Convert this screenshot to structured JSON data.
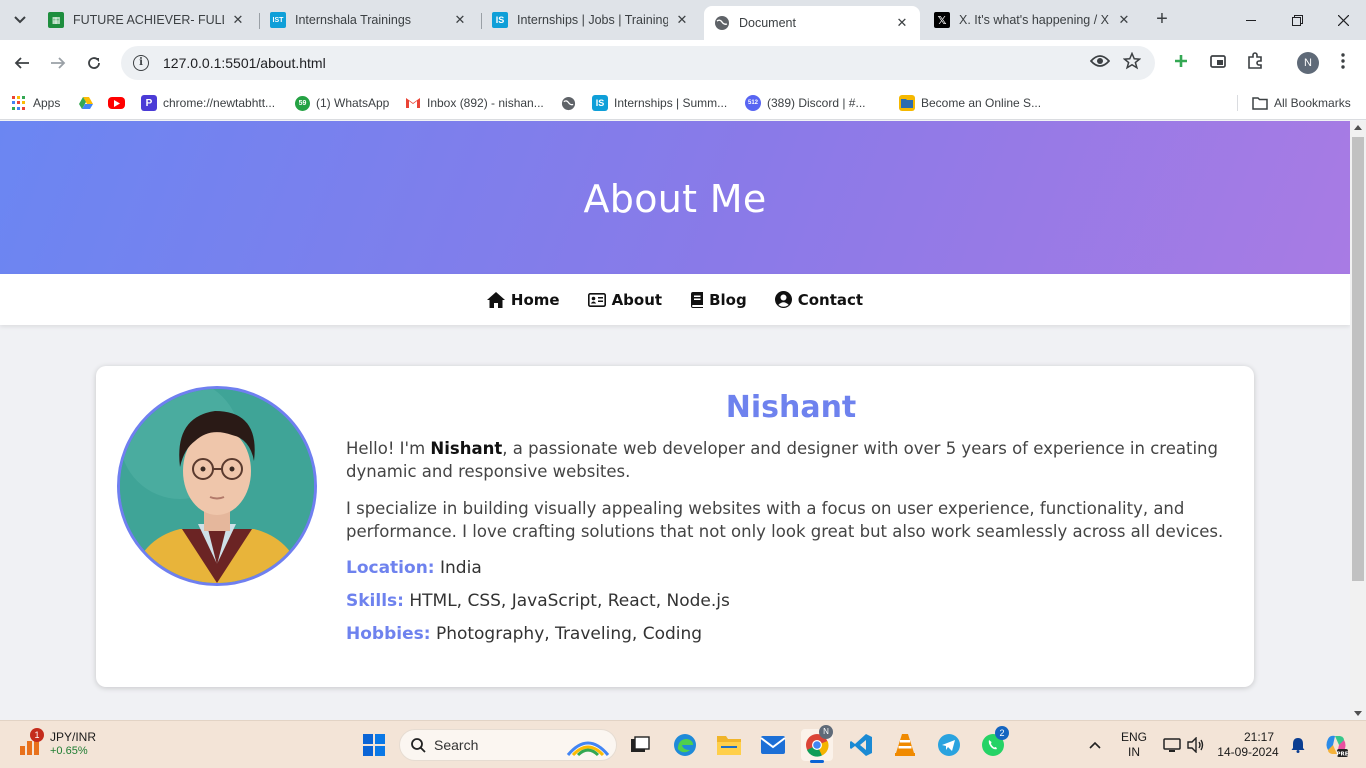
{
  "browser": {
    "tabs": [
      {
        "title": "FUTURE ACHIEVER- FULL STA",
        "favicon": "sheets-icon",
        "color": "#1e8e3e",
        "active": false
      },
      {
        "title": "Internshala Trainings",
        "favicon": "ist-icon",
        "color": "#0f9fd8",
        "active": false
      },
      {
        "title": "Internships | Jobs | Trainings",
        "favicon": "is-icon",
        "color": "#0f9fd8",
        "active": false
      },
      {
        "title": "Document",
        "favicon": "globe-icon",
        "color": "#5f6368",
        "active": true
      },
      {
        "title": "X. It's what's happening / X",
        "favicon": "x-icon",
        "color": "#000000",
        "active": false
      }
    ],
    "url": "127.0.0.1:5501/about.html",
    "profile_initial": "N",
    "bookmarks": [
      {
        "label": "Apps"
      },
      {
        "label": ""
      },
      {
        "label": ""
      },
      {
        "label": "chrome://newtabhtt..."
      },
      {
        "label": "(1) WhatsApp"
      },
      {
        "label": "Inbox (892) - nishan..."
      },
      {
        "label": ""
      },
      {
        "label": "Internships | Summ..."
      },
      {
        "label": "(389) Discord | #..."
      },
      {
        "label": "Become an Online S..."
      }
    ],
    "all_bookmarks": "All Bookmarks"
  },
  "page": {
    "hero_title": "About Me",
    "nav": [
      {
        "label": "Home",
        "icon": "home-icon"
      },
      {
        "label": "About",
        "icon": "id-card-icon"
      },
      {
        "label": "Blog",
        "icon": "blog-icon"
      },
      {
        "label": "Contact",
        "icon": "user-circle-icon"
      }
    ],
    "profile": {
      "name": "Nishant",
      "intro_before": "Hello! I'm ",
      "intro_name": "Nishant",
      "intro_after": ", a passionate web developer and designer with over 5 years of experience in creating dynamic and responsive websites.",
      "paragraph2": "I specialize in building visually appealing websites with a focus on user experience, functionality, and performance. I love crafting solutions that not only look great but also work seamlessly across all devices.",
      "details": [
        {
          "label": "Location:",
          "value": "India"
        },
        {
          "label": "Skills:",
          "value": "HTML, CSS, JavaScript, React, Node.js"
        },
        {
          "label": "Hobbies:",
          "value": "Photography, Traveling, Coding"
        }
      ]
    },
    "colors": {
      "accent": "#6e82ee",
      "hero_start": "#6b86f2",
      "hero_end": "#a87be4"
    }
  },
  "taskbar": {
    "widget_title": "JPY/INR",
    "widget_value": "+0.65%",
    "widget_badge": "1",
    "search_placeholder": "Search",
    "whatsapp_badge": "2",
    "chrome_badge": "N",
    "lang_line1": "ENG",
    "lang_line2": "IN",
    "time": "21:17",
    "date": "14-09-2024"
  }
}
